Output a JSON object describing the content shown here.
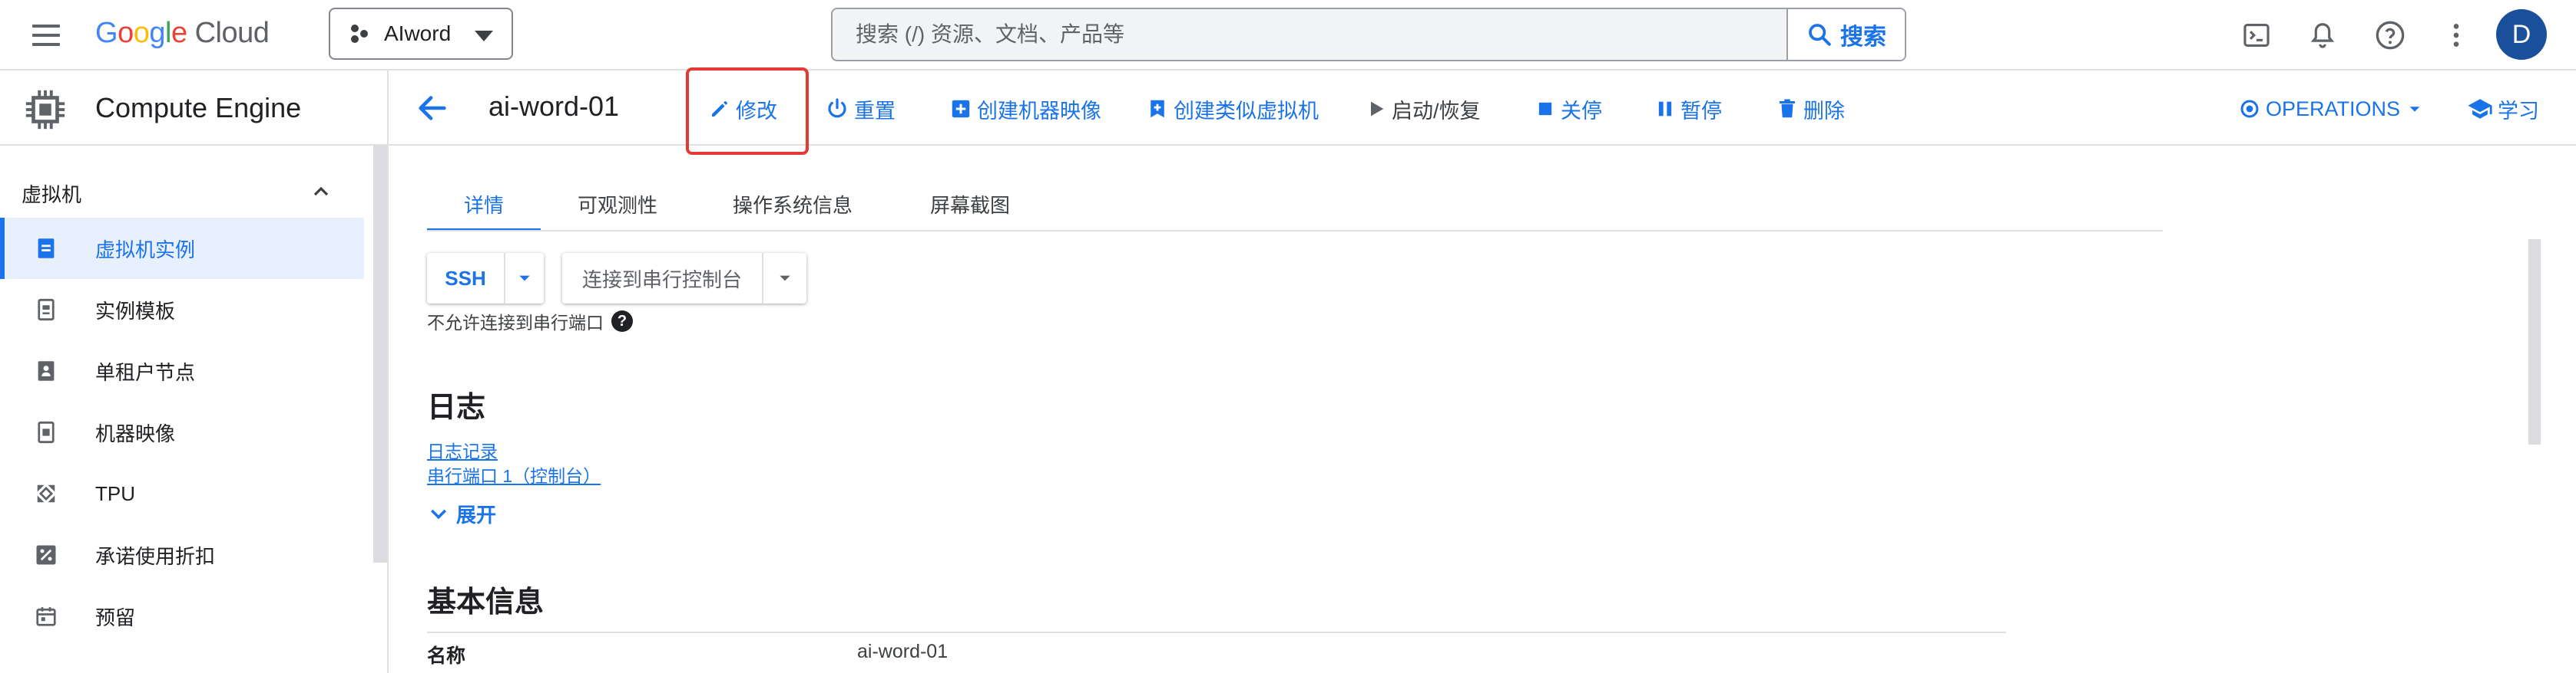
{
  "topbar": {
    "logo_google": "Google",
    "logo_cloud": "Cloud",
    "project": "AIword",
    "search_placeholder": "搜索 (/) 资源、文档、产品等",
    "search_button": "搜索",
    "avatar_letter": "D"
  },
  "product": {
    "name": "Compute Engine"
  },
  "vm": {
    "name": "ai-word-01"
  },
  "actions": {
    "edit": "修改",
    "reset": "重置",
    "create_machine_image": "创建机器映像",
    "create_similar": "创建类似虚拟机",
    "start_resume": "启动/恢复",
    "stop": "关停",
    "suspend": "暂停",
    "delete": "删除",
    "operations": "OPERATIONS",
    "learn": "学习"
  },
  "sidebar": {
    "section": "虚拟机",
    "items": [
      {
        "label": "虚拟机实例",
        "icon": "vm-instance-icon",
        "active": true
      },
      {
        "label": "实例模板",
        "icon": "instance-template-icon",
        "active": false
      },
      {
        "label": "单租户节点",
        "icon": "sole-tenant-icon",
        "active": false
      },
      {
        "label": "机器映像",
        "icon": "machine-image-icon",
        "active": false
      },
      {
        "label": "TPU",
        "icon": "tpu-icon",
        "active": false
      },
      {
        "label": "承诺使用折扣",
        "icon": "discount-icon",
        "active": false
      },
      {
        "label": "预留",
        "icon": "reservation-icon",
        "active": false
      }
    ]
  },
  "tabs": [
    {
      "label": "详情",
      "active": true
    },
    {
      "label": "可观测性",
      "active": false
    },
    {
      "label": "操作系统信息",
      "active": false
    },
    {
      "label": "屏幕截图",
      "active": false
    }
  ],
  "connect": {
    "ssh": "SSH",
    "serial": "连接到串行控制台",
    "serial_note": "不允许连接到串行端口",
    "help": "?"
  },
  "logs": {
    "title": "日志",
    "link1": "日志记录",
    "link2": "串行端口 1（控制台）",
    "expand": "展开"
  },
  "basic_info": {
    "title": "基本信息",
    "rows": [
      {
        "key": "名称",
        "value": "ai-word-01"
      }
    ]
  },
  "colors": {
    "accent": "#1a73e8",
    "highlight": "#e53935",
    "active_bg": "#e8f0fe"
  }
}
